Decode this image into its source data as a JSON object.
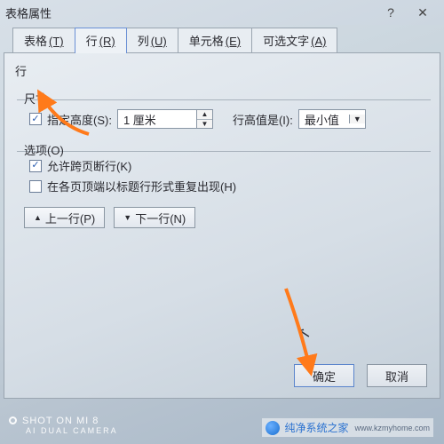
{
  "title": "表格属性",
  "tabs": [
    {
      "label": "表格",
      "mn": "(T)"
    },
    {
      "label": "行",
      "mn": "(R)"
    },
    {
      "label": "列",
      "mn": "(U)"
    },
    {
      "label": "单元格",
      "mn": "(E)"
    },
    {
      "label": "可选文字",
      "mn": "(A)"
    }
  ],
  "page": {
    "section": "行",
    "size_legend": "尺寸",
    "specify_height": {
      "label": "指定高度(S):",
      "value": "1 厘米",
      "checked": true
    },
    "row_height_rule": {
      "label": "行高值是(I):",
      "value": "最小值"
    },
    "options_legend": "选项(O)",
    "allow_break": {
      "label": "允许跨页断行(K)",
      "checked": true
    },
    "repeat_header": {
      "label": "在各页顶端以标题行形式重复出现(H)",
      "checked": false
    },
    "nav": {
      "prev_tri": "▲",
      "prev": "上一行(P)",
      "next_tri": "▼",
      "next": "下一行(N)"
    }
  },
  "buttons": {
    "ok": "确定",
    "cancel": "取消"
  },
  "watermark": {
    "camera1": "SHOT ON MI 8",
    "camera2": "AI DUAL CAMERA",
    "brand": "纯净系统之家",
    "url": "www.kzmyhome.com"
  }
}
